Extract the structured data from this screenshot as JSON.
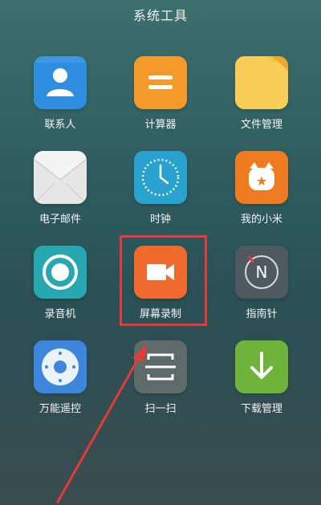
{
  "header": {
    "title": "系统工具"
  },
  "apps": [
    {
      "label": "联系人",
      "icon": "contacts-icon",
      "color": "#2f8ee0"
    },
    {
      "label": "计算器",
      "icon": "calculator-icon",
      "color": "#f39a2a"
    },
    {
      "label": "文件管理",
      "icon": "file-manager-icon",
      "color": "#f7c13a"
    },
    {
      "label": "电子邮件",
      "icon": "email-icon",
      "color": "#f2f2f2"
    },
    {
      "label": "时钟",
      "icon": "clock-icon",
      "color": "#28a2cf"
    },
    {
      "label": "我的小米",
      "icon": "mi-icon",
      "color": "#ef7b20"
    },
    {
      "label": "录音机",
      "icon": "recorder-icon",
      "color": "#27a7b0"
    },
    {
      "label": "屏幕录制",
      "icon": "screen-record-icon",
      "color": "#ef6a2c"
    },
    {
      "label": "指南针",
      "icon": "compass-icon",
      "color": "#4e5a60"
    },
    {
      "label": "万能遥控",
      "icon": "remote-control-icon",
      "color": "#3d86dc"
    },
    {
      "label": "扫一扫",
      "icon": "scan-icon",
      "color": "#5f6a6b"
    },
    {
      "label": "下载管理",
      "icon": "download-manager-icon",
      "color": "#6fb33a"
    }
  ],
  "annotation": {
    "highlight_color": "#e33a3a"
  }
}
